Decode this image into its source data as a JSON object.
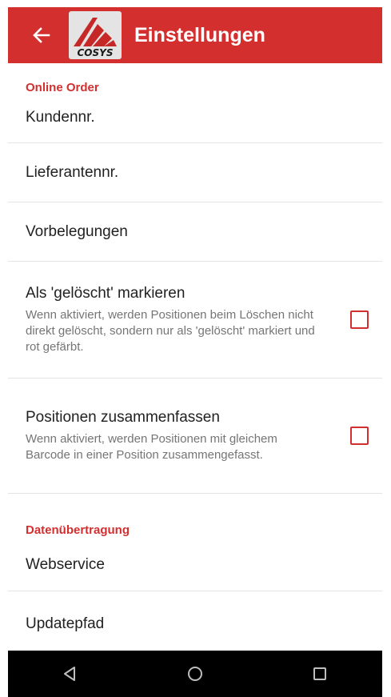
{
  "app_bar": {
    "title": "Einstellungen",
    "back_icon": "arrow-left-icon",
    "logo_text": "COSYS",
    "color": "#d32f2f"
  },
  "sections": {
    "online_order": {
      "header": "Online Order",
      "kundennr": "Kundennr.",
      "lieferantennr": "Lieferantennr.",
      "vorbelegungen": "Vorbelegungen",
      "geloescht": {
        "title": "Als 'gelöscht' markieren",
        "summary": "Wenn aktiviert, werden Positionen beim Löschen nicht direkt gelöscht, sondern nur als 'gelöscht' markiert und rot gefärbt.",
        "checked": false
      },
      "zusammenfassen": {
        "title": "Positionen zusammenfassen",
        "summary": "Wenn aktiviert, werden Positionen mit gleichem Barcode in einer Position zusammengefasst.",
        "checked": false
      }
    },
    "datenuebertragung": {
      "header": "Datenübertragung",
      "webservice": "Webservice",
      "updatepfad": "Updatepfad"
    }
  },
  "nav_bar": {
    "back_icon": "nav-back-triangle-icon",
    "home_icon": "nav-home-circle-icon",
    "recents_icon": "nav-recents-square-icon"
  }
}
